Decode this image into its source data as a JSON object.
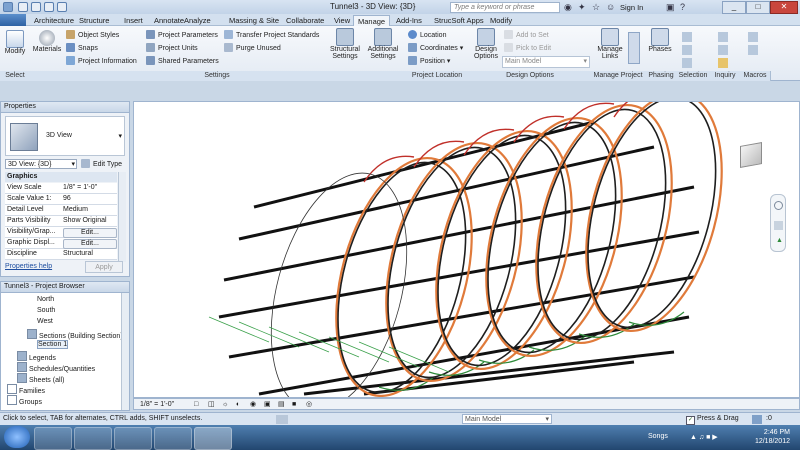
{
  "window": {
    "title": "Tunnel3 - 3D View: {3D}",
    "search_placeholder": "Type a keyword or phrase",
    "sign_in": "Sign In"
  },
  "tabs": [
    "Architecture",
    "Structure",
    "Insert",
    "Annotate",
    "Analyze",
    "Massing & Site",
    "Collaborate",
    "View",
    "Manage",
    "Add-Ins",
    "StrucSoft Apps",
    "Modify"
  ],
  "active_tab": "Manage",
  "ribbon": {
    "modify": "Modify",
    "materials": "Materials",
    "object_styles": "Object Styles",
    "snaps": "Snaps",
    "project_information": "Project Information",
    "project_parameters": "Project Parameters",
    "project_units": "Project Units",
    "shared_parameters": "Shared Parameters",
    "transfer_project_standards": "Transfer Project Standards",
    "purge_unused": "Purge Unused",
    "structural_settings": "Structural Settings",
    "additional_settings": "Additional Settings",
    "location": "Location",
    "coordinates": "Coordinates",
    "position": "Position",
    "design_options": "Design Options",
    "add_to_set": "Add to Set",
    "pick_to_edit": "Pick to Edit",
    "main_model": "Main Model",
    "manage_links": "Manage Links",
    "phases": "Phases",
    "groups": {
      "select": "Select",
      "settings": "Settings",
      "project_location": "Project Location",
      "design_options": "Design Options",
      "manage_project": "Manage Project",
      "phasing": "Phasing",
      "selection": "Selection",
      "inquiry": "Inquiry",
      "macros": "Macros"
    }
  },
  "properties": {
    "header": "Properties",
    "type_name": "3D View",
    "selector": "3D View: {3D}",
    "edit_type": "Edit Type",
    "category": "Graphics",
    "rows": [
      {
        "label": "View Scale",
        "value": "1/8\" = 1'-0\""
      },
      {
        "label": "Scale Value 1:",
        "value": "96"
      },
      {
        "label": "Detail Level",
        "value": "Medium"
      },
      {
        "label": "Parts Visibility",
        "value": "Show Original"
      },
      {
        "label": "Visibility/Grap...",
        "value": "Edit..."
      },
      {
        "label": "Graphic Displ...",
        "value": "Edit..."
      },
      {
        "label": "Discipline",
        "value": "Structural"
      }
    ],
    "help": "Properties help",
    "apply": "Apply"
  },
  "browser": {
    "header": "Tunnel3 - Project Browser",
    "items": [
      {
        "label": "North",
        "level": 3
      },
      {
        "label": "South",
        "level": 3
      },
      {
        "label": "West",
        "level": 3
      },
      {
        "label": "Sections (Building Section)",
        "level": 2
      },
      {
        "label": "Section 1",
        "level": 3
      },
      {
        "label": "Legends",
        "level": 1
      },
      {
        "label": "Schedules/Quantities",
        "level": 1
      },
      {
        "label": "Sheets (all)",
        "level": 1
      },
      {
        "label": "Families",
        "level": 0
      },
      {
        "label": "Groups",
        "level": 0
      }
    ]
  },
  "view_control": {
    "scale": "1/8\" = 1'-0\""
  },
  "statusbar": {
    "hint": "Click to select, TAB for alternates, CTRL adds, SHIFT unselects.",
    "model": "Main Model",
    "press_drag": "Press & Drag",
    "filter_count": ":0"
  },
  "taskbar": {
    "songs": "Songs",
    "time": "2:46 PM",
    "date": "12/18/2012"
  },
  "colors": {
    "hoop_outer": "#e07a3a",
    "hoop_inner": "#1e1e1e",
    "hoop_red": "#c0302a",
    "hoop_green": "#2e8b3a",
    "leader_green": "#3aa04a"
  }
}
